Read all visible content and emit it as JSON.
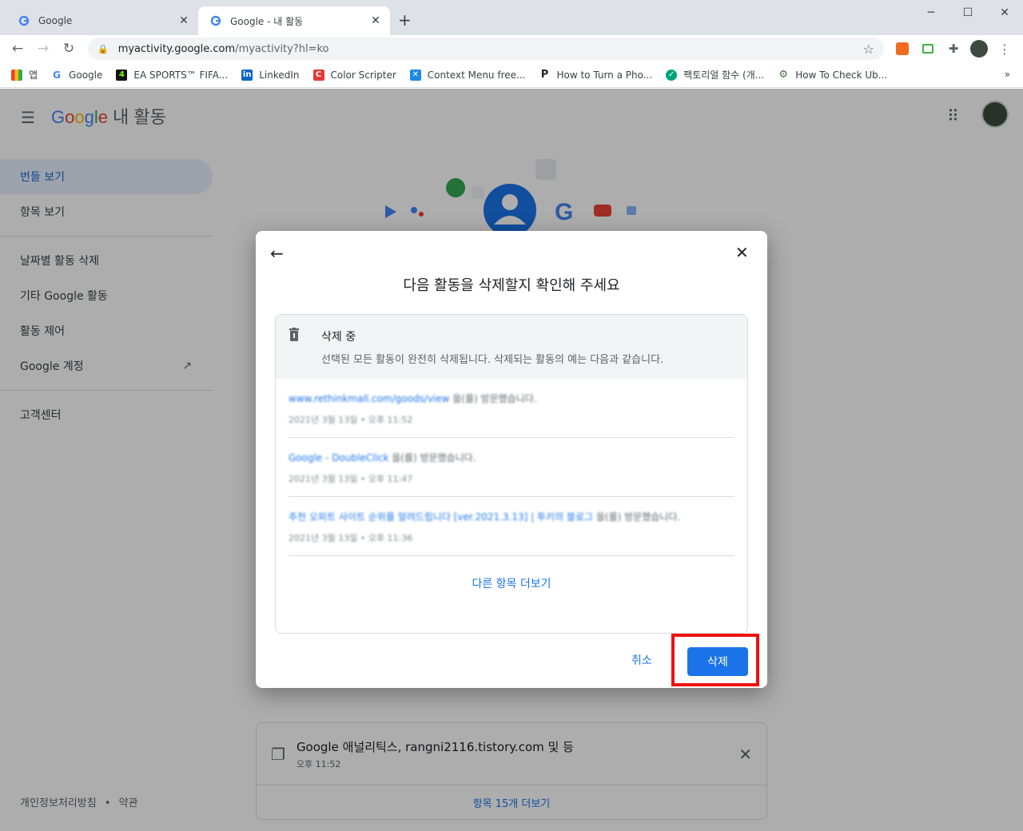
{
  "browser": {
    "tabs": [
      {
        "title": "Google"
      },
      {
        "title": "Google - 내 활동"
      }
    ],
    "url_host": "myactivity.google.com",
    "url_path": "/myactivity?hl=ko",
    "bookmarks": [
      {
        "label": "앱",
        "icon": "apps-grid-icon",
        "color": "#ea4335"
      },
      {
        "label": "Google",
        "icon": "google-icon",
        "color": "#4285f4"
      },
      {
        "label": "EA SPORTS™ FIFA...",
        "icon": "ea-sports-icon",
        "color": "#111111"
      },
      {
        "label": "LinkedIn",
        "icon": "linkedin-icon",
        "color": "#0a66c2"
      },
      {
        "label": "Color Scripter",
        "icon": "color-scripter-icon",
        "color": "#e53935"
      },
      {
        "label": "Context Menu free...",
        "icon": "context-menu-icon",
        "color": "#1e88e5"
      },
      {
        "label": "How to Turn a Pho...",
        "icon": "p-logo-icon",
        "color": "#222222"
      },
      {
        "label": "팩토리얼 함수 (개...",
        "icon": "shield-logo-icon",
        "color": "#00a37a"
      },
      {
        "label": "How To Check Ub...",
        "icon": "gear-logo-icon",
        "color": "#3d7a3d"
      }
    ]
  },
  "app": {
    "logo": "Google",
    "product": "내 활동",
    "sidebar": [
      {
        "label": "번들 보기",
        "active": true
      },
      {
        "label": "항목 보기",
        "active": false
      },
      {
        "label": "날짜별 활동 삭제",
        "active": false
      },
      {
        "label": "기타 Google 활동",
        "active": false
      },
      {
        "label": "활동 제어",
        "active": false
      },
      {
        "label": "Google 계정",
        "active": false
      },
      {
        "label": "고객센터",
        "active": false
      }
    ],
    "footer": {
      "privacy": "개인정보처리방침",
      "sep": "•",
      "terms": "약관"
    },
    "bundle_card": {
      "title": "Google 애널리틱스, rangni2116.tistory.com 및 등",
      "time": "오후 11:52",
      "more": "항목 15개 더보기"
    }
  },
  "dialog": {
    "title": "다음 활동을 삭제할지 확인해 주세요",
    "section_title": "삭제 중",
    "section_desc": "선택된 모든 활동이 완전히 삭제됩니다. 삭제되는 활동의 예는 다음과 같습니다.",
    "activities": [
      {
        "link": "www.rethinkmall.com/goods/view",
        "rest": " 을(를) 방문했습니다.",
        "date": "2021년 3월 13일 • 오후 11:52"
      },
      {
        "link": "Google - DoubleClick",
        "rest": " 을(를) 방문했습니다.",
        "date": "2021년 3월 13일 • 오후 11:47"
      },
      {
        "link": "추천 오피트 사이트 순위를 알려드립니다 [ver.2021.3.13] | 투키의 블로그",
        "rest": " 을(를) 방문했습니다.",
        "date": "2021년 3월 13일 • 오후 11:36"
      }
    ],
    "load_more": "다른 항목 더보기",
    "cancel": "취소",
    "delete": "삭제"
  },
  "colors": {
    "accent": "#1a73e8",
    "highlight": "#ee1111"
  }
}
